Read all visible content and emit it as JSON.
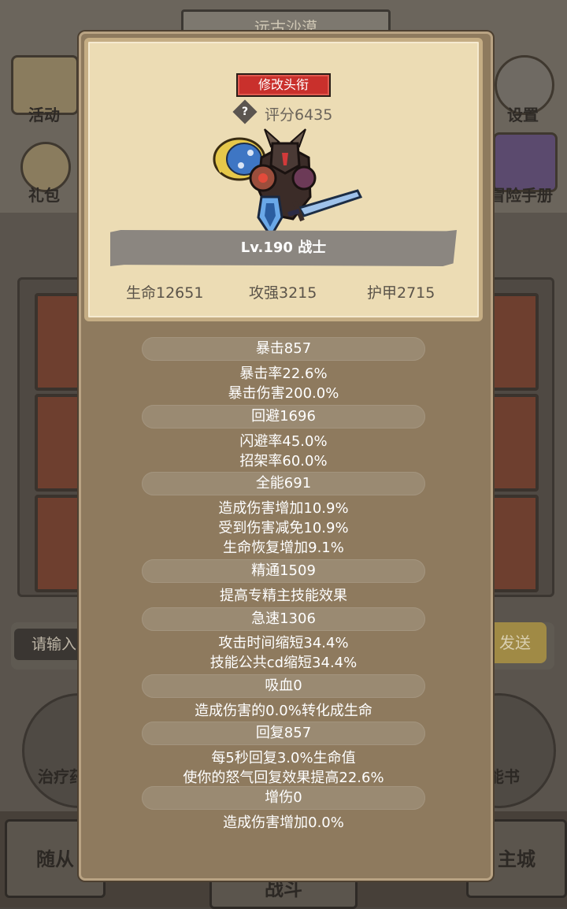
{
  "background": {
    "map_title": "远古沙漠",
    "btn_activity": "活动",
    "btn_gift": "礼包",
    "btn_settings": "设置",
    "btn_handbook": "冒险手册",
    "input_placeholder": "请输入",
    "send_label": "发送",
    "heal_potion": "治疗药",
    "skill_book": "能书",
    "tab_follower": "随从",
    "tab_battle": "战斗",
    "tab_city": "主城"
  },
  "profile": {
    "change_title_button": "修改头衔",
    "help_icon": "?",
    "score": "评分6435",
    "level_class": "Lv.190 战士",
    "hp": "生命12651",
    "attack": "攻强3215",
    "armor": "护甲2715"
  },
  "attributes": [
    {
      "name": "暴击857",
      "details": [
        "暴击率22.6%",
        "暴击伤害200.0%"
      ]
    },
    {
      "name": "回避1696",
      "details": [
        "闪避率45.0%",
        "招架率60.0%"
      ]
    },
    {
      "name": "全能691",
      "details": [
        "造成伤害增加10.9%",
        "受到伤害减免10.9%",
        "生命恢复增加9.1%"
      ]
    },
    {
      "name": "精通1509",
      "details": [
        "提高专精主技能效果"
      ]
    },
    {
      "name": "急速1306",
      "details": [
        "攻击时间缩短34.4%",
        "技能公共cd缩短34.4%"
      ]
    },
    {
      "name": "吸血0",
      "details": [
        "造成伤害的0.0%转化成生命"
      ]
    },
    {
      "name": "回复857",
      "details": [
        "每5秒回复3.0%生命值",
        "使你的怒气回复效果提高22.6%"
      ]
    },
    {
      "name": "增伤0",
      "details": [
        "造成伤害增加0.0%"
      ]
    }
  ]
}
